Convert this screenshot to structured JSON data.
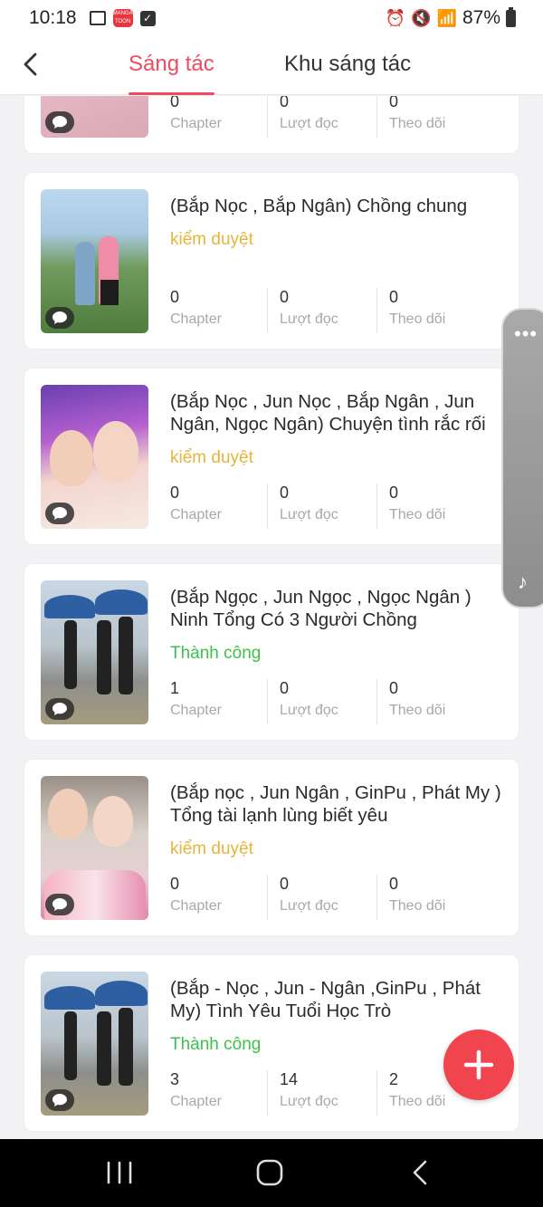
{
  "status_bar": {
    "time": "10:18",
    "app_badge": "MANGA TOON",
    "battery": "87%"
  },
  "header": {
    "tabs": [
      {
        "label": "Sáng tác",
        "active": true
      },
      {
        "label": "Khu sáng tác",
        "active": false
      }
    ],
    "accent": "#ef4b5f"
  },
  "stat_labels": {
    "chapters": "Chapter",
    "reads": "Lượt đọc",
    "follows": "Theo dõi"
  },
  "works": [
    {
      "title": "",
      "status": "",
      "chapters": "0",
      "reads": "0",
      "follows": "0"
    },
    {
      "title": "(Bắp Nọc , Bắp Ngân) Chồng chung",
      "status": "kiểm duyệt",
      "chapters": "0",
      "reads": "0",
      "follows": "0"
    },
    {
      "title": "(Bắp Nọc , Jun Nọc , Bắp Ngân , Jun Ngân, Ngọc Ngân) Chuyện tình rắc rối",
      "status": "kiểm duyệt",
      "chapters": "0",
      "reads": "0",
      "follows": "0"
    },
    {
      "title": "(Bắp Ngọc , Jun Ngọc , Ngọc Ngân ) Ninh Tổng Có 3 Người Chồng",
      "status": "Thành công",
      "chapters": "1",
      "reads": "0",
      "follows": "0"
    },
    {
      "title": "(Bắp nọc , Jun Ngân , GinPu , Phát My ) Tổng tài lạnh lùng biết yêu",
      "status": "kiểm duyệt",
      "chapters": "0",
      "reads": "0",
      "follows": "0"
    },
    {
      "title": "(Bắp - Nọc , Jun - Ngân ,GinPu , Phát My) Tình Yêu Tuổi Học Trò",
      "status": "Thành công",
      "chapters": "3",
      "reads": "14",
      "follows": "2"
    }
  ],
  "colors": {
    "status_review": "#e8b53a",
    "status_success": "#3cc24a",
    "fab": "#f0454f"
  },
  "icons": {
    "back": "chevron-left-icon",
    "comment": "chat-bubble-icon",
    "add": "plus-icon",
    "side_menu": "more-dots-icon",
    "music": "music-note-icon"
  }
}
